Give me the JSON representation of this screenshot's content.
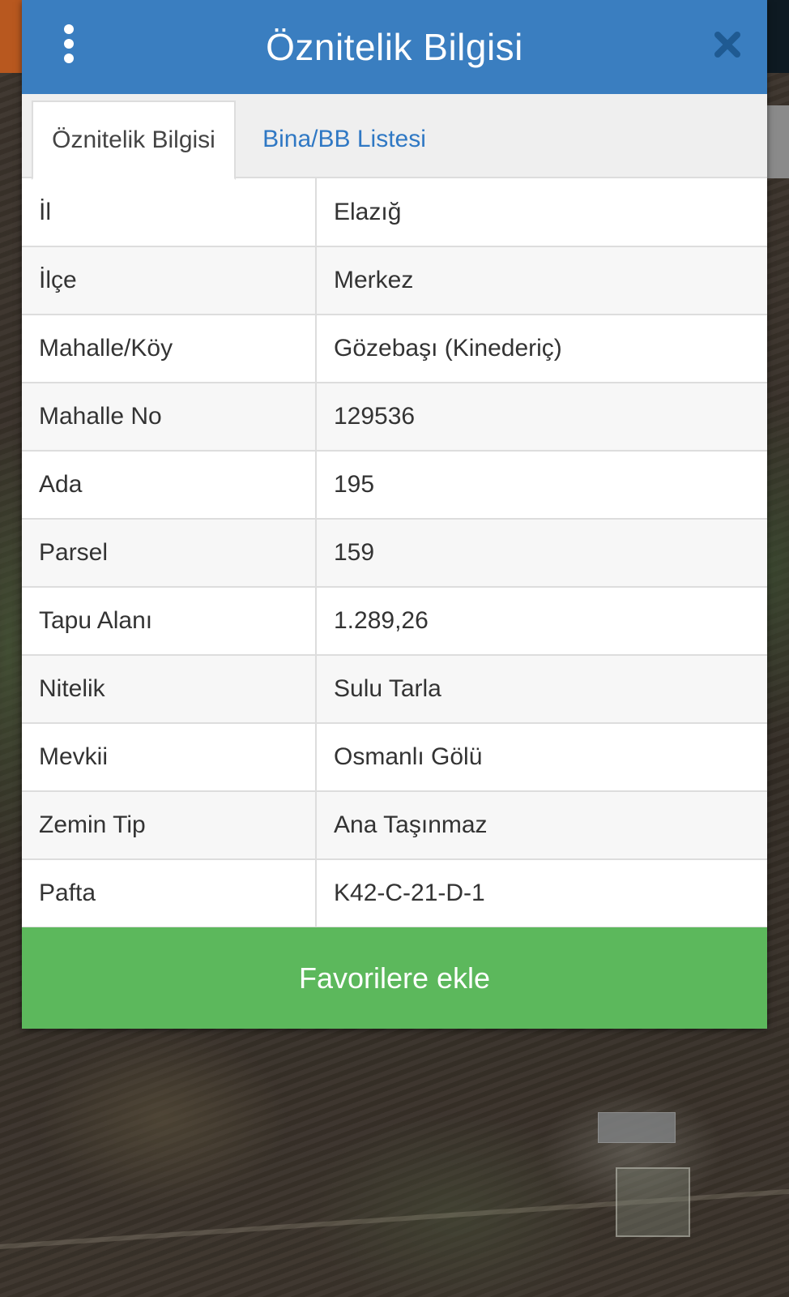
{
  "header": {
    "title": "Öznitelik Bilgisi",
    "menu_icon": "vertical-dots-icon",
    "close_icon": "close-icon",
    "color": "#3a7ec0"
  },
  "tabs": [
    {
      "label": "Öznitelik Bilgisi",
      "active": true
    },
    {
      "label": "Bina/BB Listesi",
      "active": false
    }
  ],
  "attributes": [
    {
      "key": "İl",
      "value": "Elazığ"
    },
    {
      "key": "İlçe",
      "value": "Merkez"
    },
    {
      "key": "Mahalle/Köy",
      "value": "Gözebaşı (Kinederiç)"
    },
    {
      "key": "Mahalle No",
      "value": "129536"
    },
    {
      "key": "Ada",
      "value": "195"
    },
    {
      "key": "Parsel",
      "value": "159"
    },
    {
      "key": "Tapu Alanı",
      "value": "1.289,26"
    },
    {
      "key": "Nitelik",
      "value": "Sulu Tarla"
    },
    {
      "key": "Mevkii",
      "value": "Osmanlı Gölü"
    },
    {
      "key": "Zemin Tip",
      "value": "Ana Taşınmaz"
    },
    {
      "key": "Pafta",
      "value": "K42-C-21-D-1"
    }
  ],
  "footer": {
    "favorite_label": "Favorilere ekle",
    "color": "#5cb85c"
  }
}
